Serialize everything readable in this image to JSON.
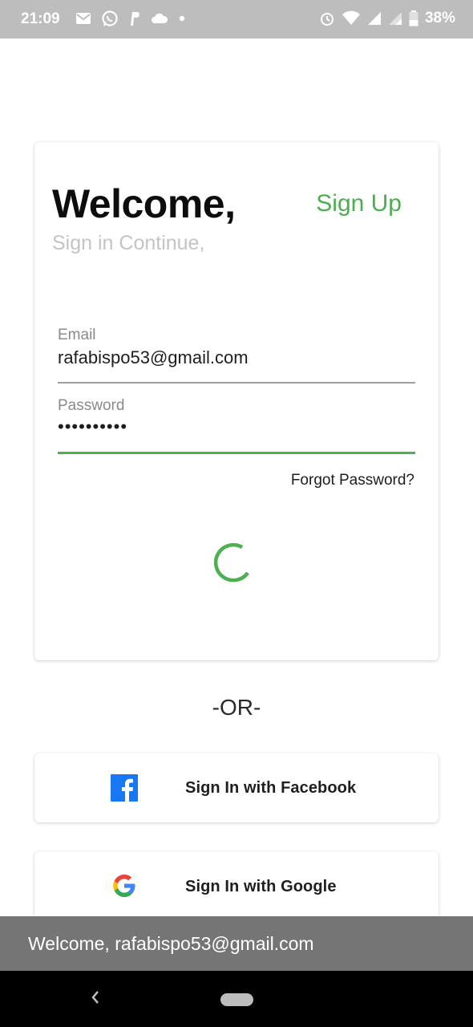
{
  "status_bar": {
    "time": "21:09",
    "battery": "38%",
    "left_icons": [
      "gmail-icon",
      "whatsapp-icon",
      "paypal-icon",
      "cloud-icon",
      "dot-icon"
    ],
    "right_icons": [
      "alarm-icon",
      "wifi-icon",
      "signal-icon",
      "signal-icon",
      "battery-icon"
    ]
  },
  "login": {
    "title": "Welcome,",
    "signup_label": "Sign Up",
    "subtitle": "Sign in Continue,",
    "email_label": "Email",
    "email_value": "rafabispo53@gmail.com",
    "password_label": "Password",
    "password_value": "••••••••••",
    "forgot_label": "Forgot Password?"
  },
  "divider": "-OR-",
  "social": {
    "facebook_label": "Sign In with Facebook",
    "google_label": "Sign In with Google"
  },
  "snackbar": {
    "message": "Welcome, rafabispo53@gmail.com"
  },
  "colors": {
    "accent": "#4caf50",
    "status_bar": "#bdbdbd",
    "snackbar": "#757575",
    "facebook": "#1877f2"
  }
}
